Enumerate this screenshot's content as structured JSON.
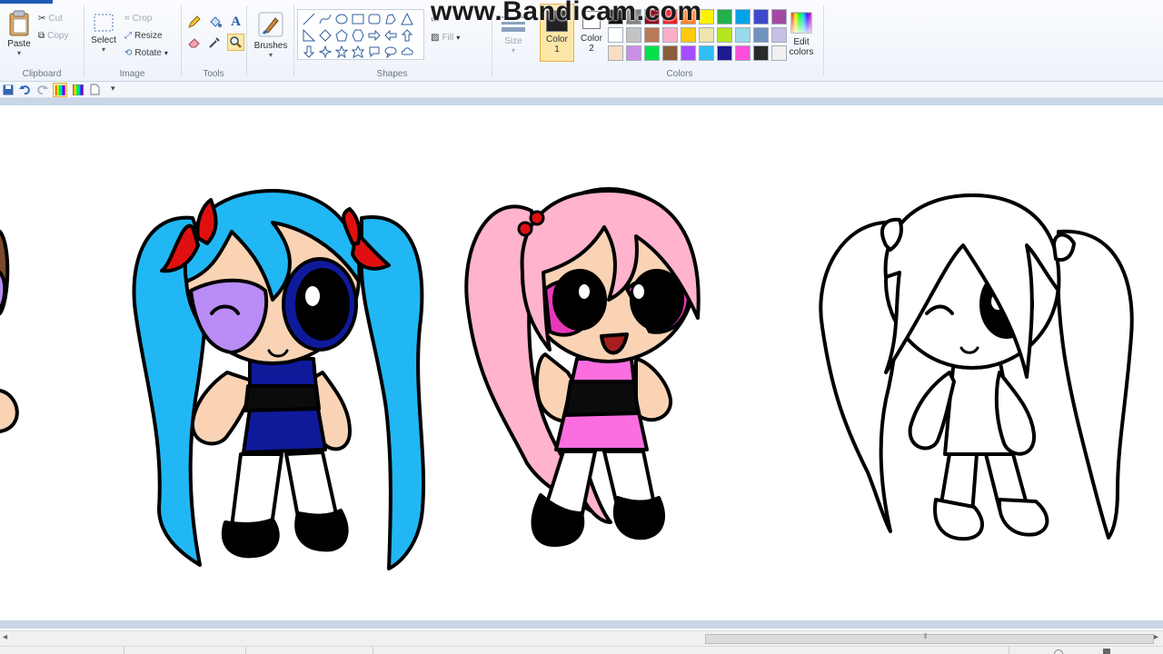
{
  "watermark": "www.Bandicam.com",
  "ribbon": {
    "clipboard": {
      "paste": "Paste",
      "cut": "Cut",
      "copy": "Copy",
      "label": "Clipboard"
    },
    "image": {
      "select": "Select",
      "crop": "Crop",
      "resize": "Resize",
      "rotate": "Rotate",
      "label": "Image"
    },
    "tools": {
      "label": "Tools",
      "text_tool": "A"
    },
    "brushes": {
      "label": "Brushes"
    },
    "shapes": {
      "label": "Shapes",
      "fill": "Fill"
    },
    "size": {
      "label": "Size"
    },
    "colors": {
      "color1": "Color",
      "color1_num": "1",
      "color2": "Color",
      "color2_num": "2",
      "edit1": "Edit",
      "edit2": "colors",
      "label": "Colors",
      "color1_value": "#222222",
      "color2_value": "#ffffff",
      "palette": [
        "#000000",
        "#7f7f7f",
        "#880015",
        "#ed1c24",
        "#ff7f27",
        "#fff200",
        "#22b14c",
        "#00a2e8",
        "#3f48cc",
        "#a349a4",
        "#ffffff",
        "#c3c3c3",
        "#b97a57",
        "#ffaec9",
        "#ffc90e",
        "#efe4b0",
        "#b5e61d",
        "#99d9ea",
        "#7092be",
        "#c8bfe7",
        "#f9dcc4",
        "#cc8fe6",
        "#00e14a",
        "#8a5c3a",
        "#a64dff",
        "#2fbdf5",
        "#1b1b8f",
        "#ff4fd8",
        "#2a2a2a",
        "#f0f0f0"
      ]
    }
  },
  "colors_used": {
    "skin": "#f9d3b4",
    "blue_hair": "#21b7f4",
    "navy": "#0f1a9b",
    "purple": "#b98cf6",
    "red_bow": "#e01010",
    "pink_hair": "#ffb3cc",
    "pink_dress": "#fa6ee0",
    "magenta": "#e838b9"
  }
}
